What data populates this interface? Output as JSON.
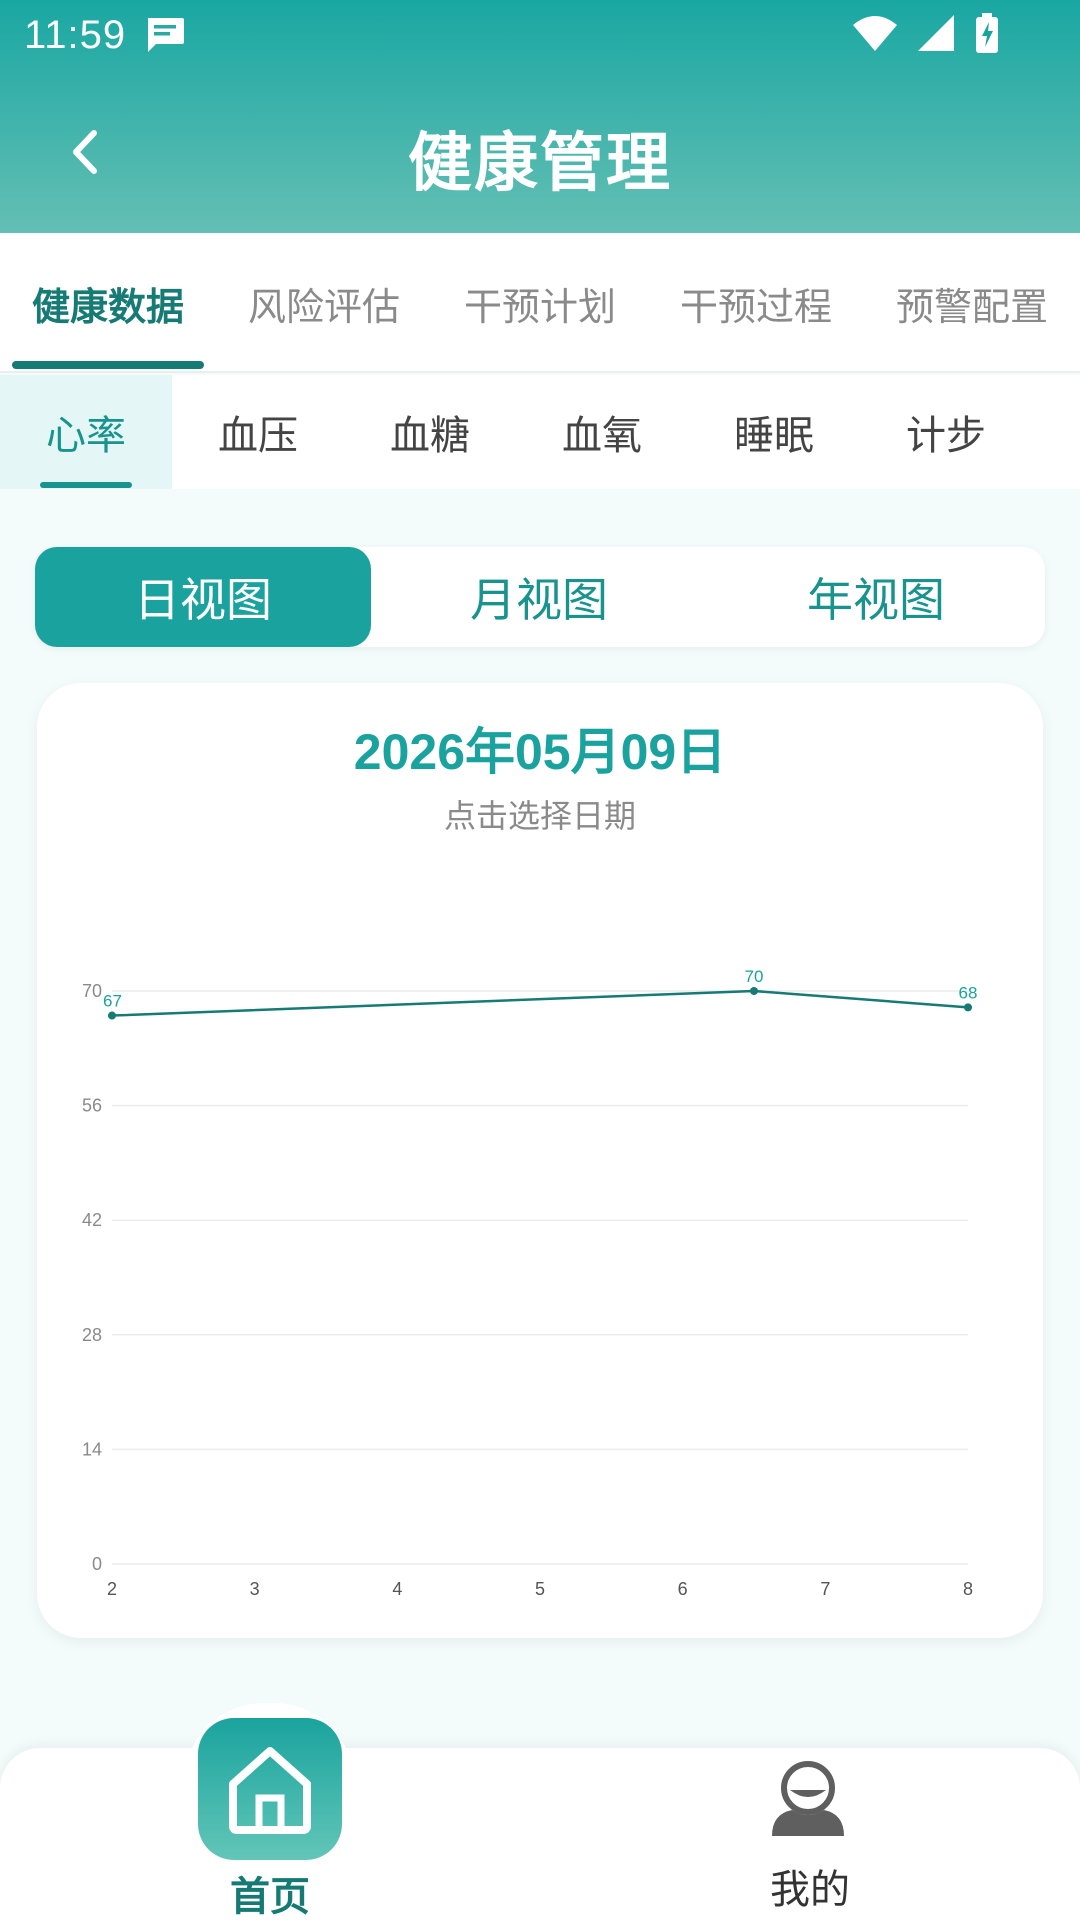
{
  "status_bar": {
    "time": "11:59"
  },
  "header": {
    "title": "健康管理"
  },
  "top_tabs": [
    {
      "label": "健康数据",
      "active": true
    },
    {
      "label": "风险评估",
      "active": false
    },
    {
      "label": "干预计划",
      "active": false
    },
    {
      "label": "干预过程",
      "active": false
    },
    {
      "label": "预警配置",
      "active": false
    }
  ],
  "sub_tabs": [
    {
      "label": "心率",
      "active": true
    },
    {
      "label": "血压",
      "active": false
    },
    {
      "label": "血糖",
      "active": false
    },
    {
      "label": "血氧",
      "active": false
    },
    {
      "label": "睡眠",
      "active": false
    },
    {
      "label": "计步",
      "active": false
    }
  ],
  "view_toggle": [
    {
      "label": "日视图",
      "active": true
    },
    {
      "label": "月视图",
      "active": false
    },
    {
      "label": "年视图",
      "active": false
    }
  ],
  "chart_card": {
    "date": "2026年05月09日",
    "hint": "点击选择日期"
  },
  "chart_data": {
    "type": "line",
    "x_ticks": [
      2,
      3,
      4,
      5,
      6,
      7,
      8
    ],
    "y_ticks": [
      0,
      14,
      28,
      42,
      56,
      70
    ],
    "xlim": [
      2,
      8
    ],
    "ylim": [
      0,
      70
    ],
    "grid": true,
    "points": [
      {
        "x": 2,
        "y": 67
      },
      {
        "x": 6.5,
        "y": 70
      },
      {
        "x": 8,
        "y": 68
      }
    ],
    "line_color": "#167a75",
    "label_color": "#1aa39e"
  },
  "bottom_nav": {
    "home_label": "首页",
    "mine_label": "我的"
  },
  "colors": {
    "accent": "#1aa39e",
    "dark_accent": "#167a75"
  }
}
